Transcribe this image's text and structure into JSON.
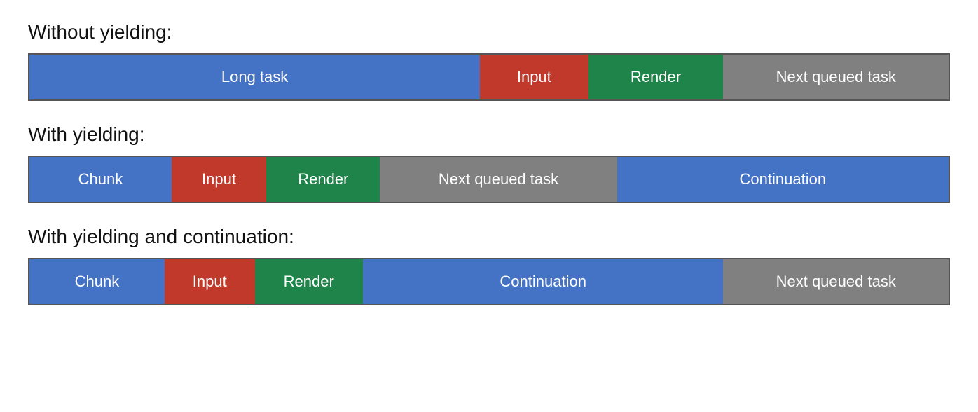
{
  "diagram1": {
    "title": "Without yielding:",
    "segments": [
      {
        "label": "Long task",
        "color": "blue",
        "flex": 5
      },
      {
        "label": "Input",
        "color": "red",
        "flex": 1.2
      },
      {
        "label": "Render",
        "color": "green",
        "flex": 1.5
      },
      {
        "label": "Next queued task",
        "color": "gray",
        "flex": 2.5
      }
    ]
  },
  "diagram2": {
    "title": "With yielding:",
    "segments": [
      {
        "label": "Chunk",
        "color": "blue",
        "flex": 1.5
      },
      {
        "label": "Input",
        "color": "red",
        "flex": 1
      },
      {
        "label": "Render",
        "color": "green",
        "flex": 1.2
      },
      {
        "label": "Next queued task",
        "color": "gray",
        "flex": 2.5
      },
      {
        "label": "Continuation",
        "color": "blue",
        "flex": 3.5
      }
    ]
  },
  "diagram3": {
    "title": "With yielding and continuation:",
    "segments": [
      {
        "label": "Chunk",
        "color": "blue",
        "flex": 1.5
      },
      {
        "label": "Input",
        "color": "red",
        "flex": 1
      },
      {
        "label": "Render",
        "color": "green",
        "flex": 1.2
      },
      {
        "label": "Continuation",
        "color": "blue",
        "flex": 4
      },
      {
        "label": "Next queued task",
        "color": "gray",
        "flex": 2.5
      }
    ]
  }
}
